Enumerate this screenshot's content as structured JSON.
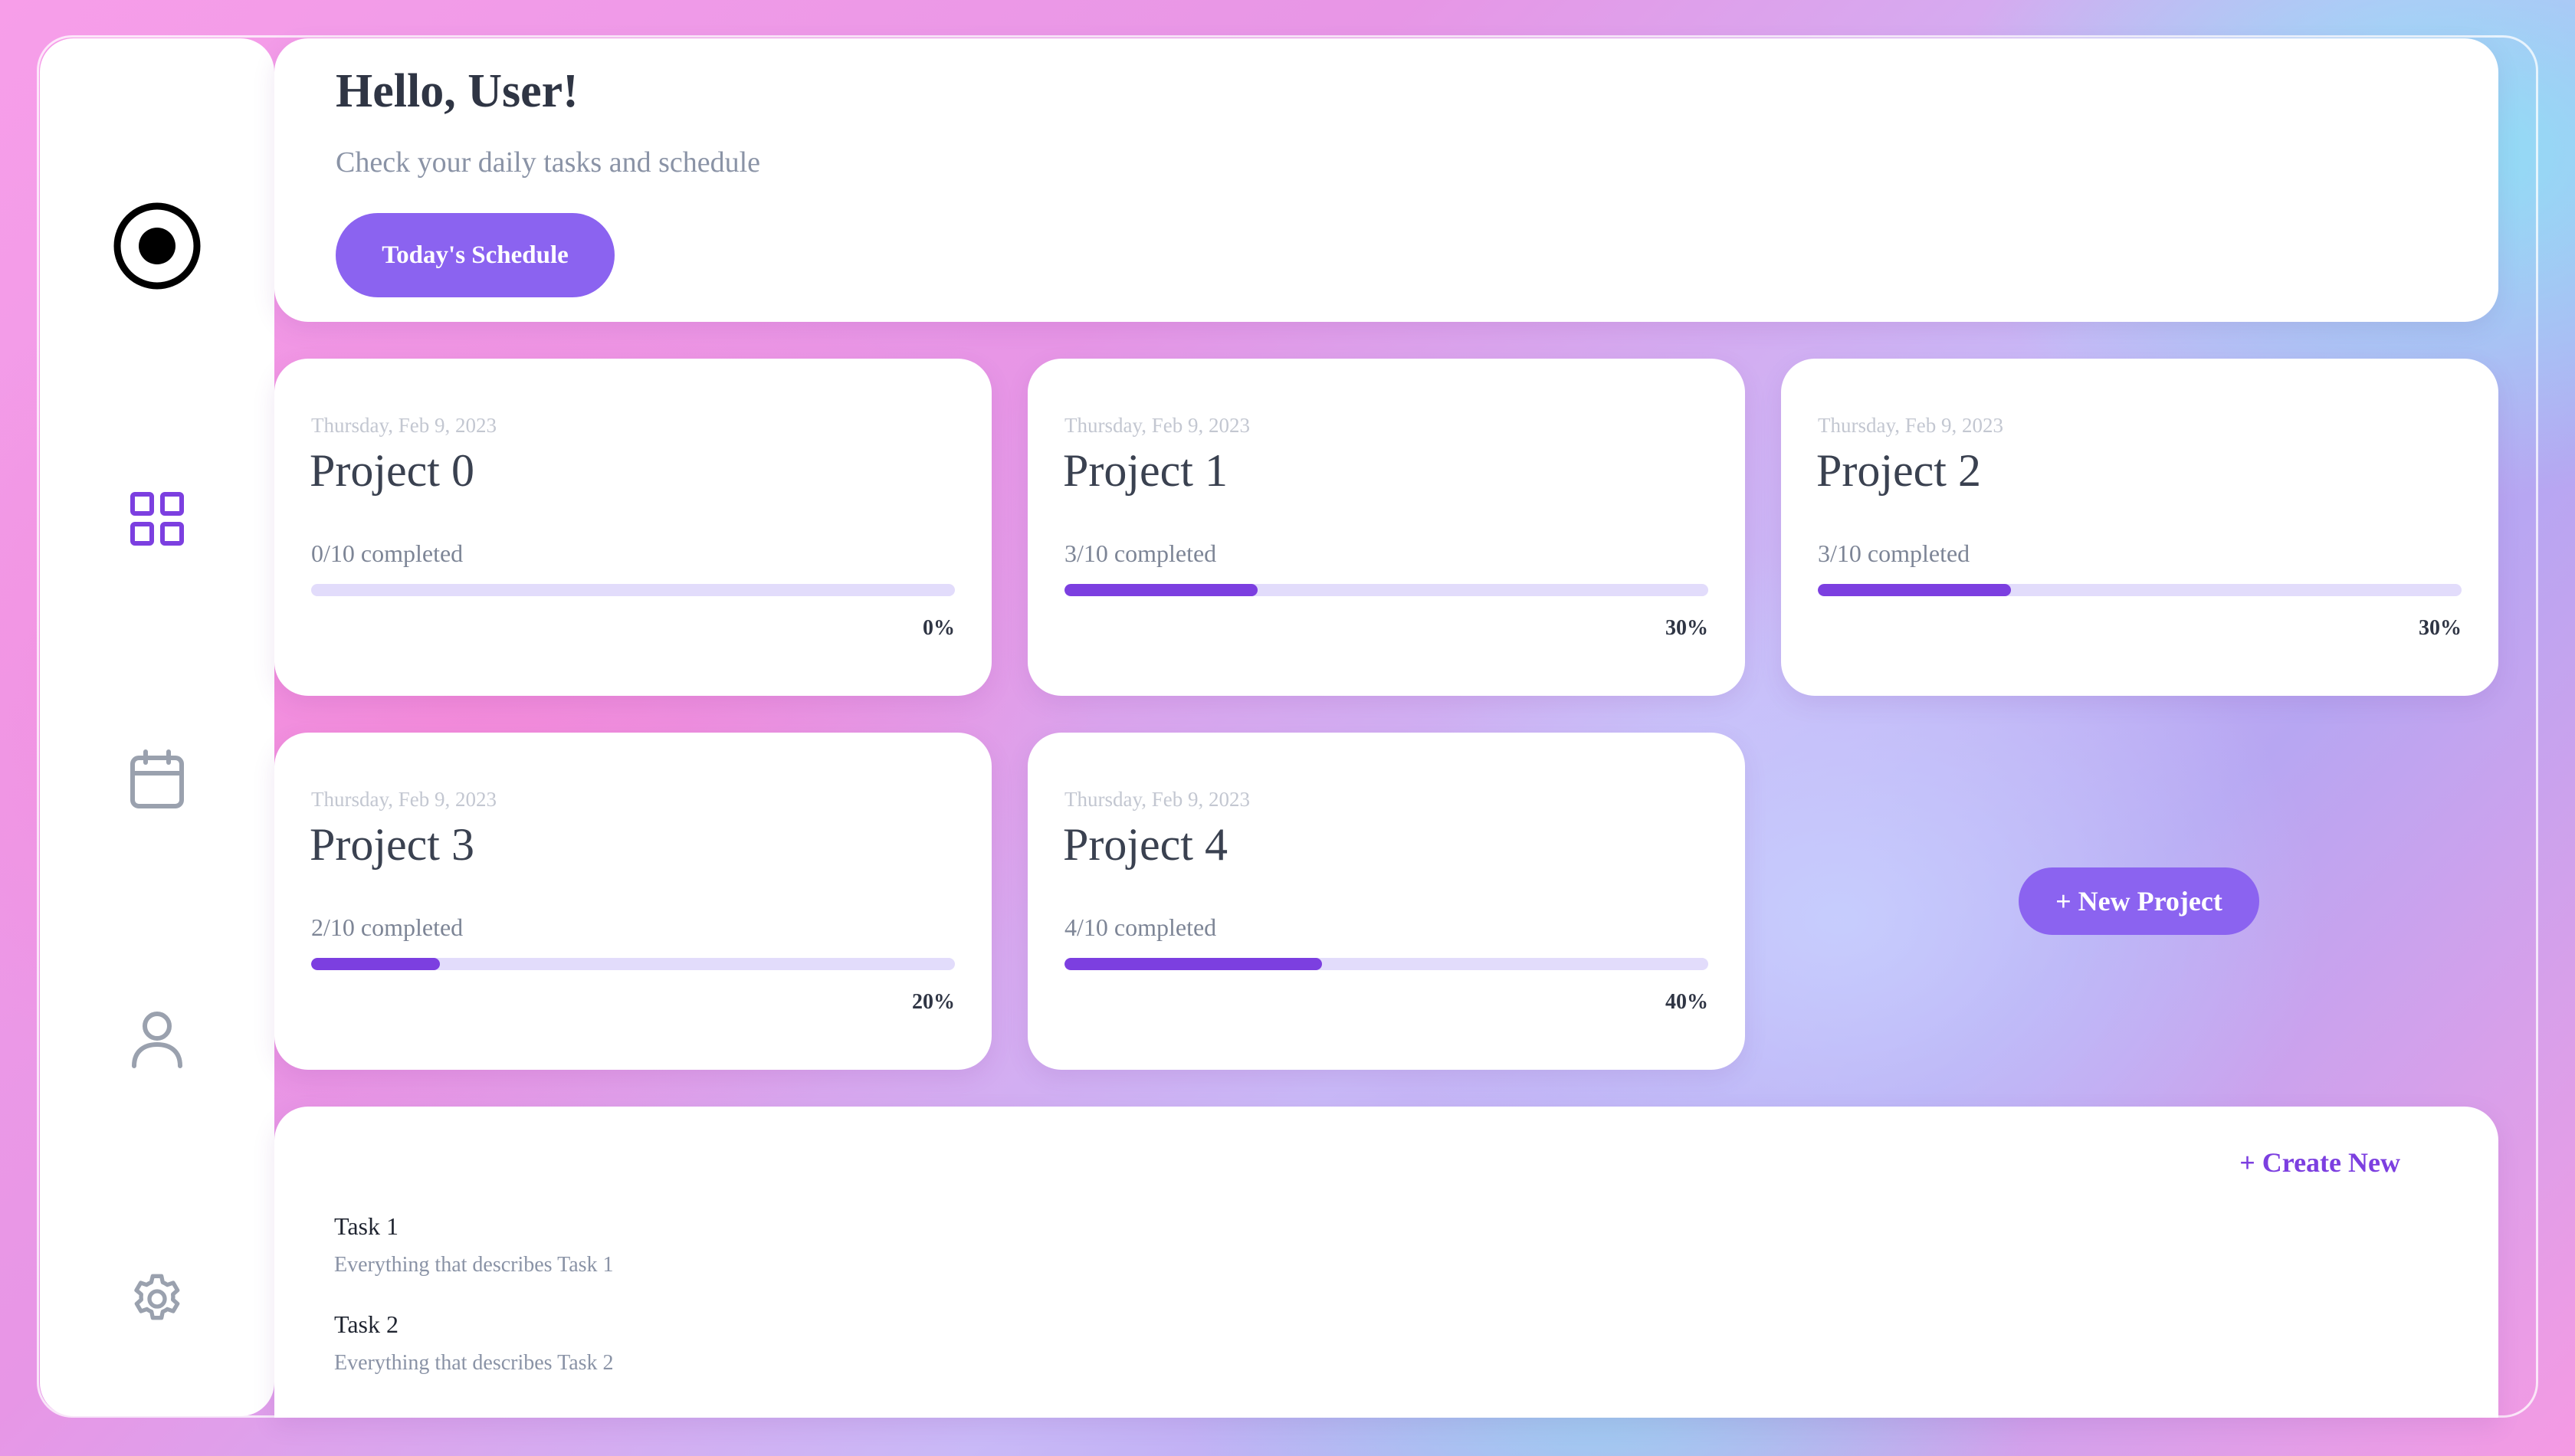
{
  "header": {
    "greeting": "Hello, User!",
    "subtitle": "Check your daily tasks and schedule",
    "schedule_button": "Today's Schedule"
  },
  "sidebar": {
    "items": [
      {
        "icon": "logo-icon",
        "active": false
      },
      {
        "icon": "dashboard-grid-icon",
        "active": true
      },
      {
        "icon": "calendar-icon",
        "active": false
      },
      {
        "icon": "user-icon",
        "active": false
      },
      {
        "icon": "settings-gear-icon",
        "active": false
      }
    ]
  },
  "projects": [
    {
      "date": "Thursday, Feb 9, 2023",
      "name": "Project 0",
      "completed": "0/10 completed",
      "percent_label": "0%",
      "progress": 0
    },
    {
      "date": "Thursday, Feb 9, 2023",
      "name": "Project 1",
      "completed": "3/10 completed",
      "percent_label": "30%",
      "progress": 30
    },
    {
      "date": "Thursday, Feb 9, 2023",
      "name": "Project 2",
      "completed": "3/10 completed",
      "percent_label": "30%",
      "progress": 30
    },
    {
      "date": "Thursday, Feb 9, 2023",
      "name": "Project 3",
      "completed": "2/10 completed",
      "percent_label": "20%",
      "progress": 20
    },
    {
      "date": "Thursday, Feb 9, 2023",
      "name": "Project 4",
      "completed": "4/10 completed",
      "percent_label": "40%",
      "progress": 40
    }
  ],
  "new_project_button": "+ New Project",
  "tasks": {
    "create_label": "+ Create New",
    "items": [
      {
        "title": "Task 1",
        "description": "Everything that describes Task 1"
      },
      {
        "title": "Task 2",
        "description": "Everything that describes Task 2"
      }
    ]
  },
  "colors": {
    "accent": "#8b63f0",
    "progress_fill": "#7c3fe0",
    "progress_track": "#e2dcfb",
    "text_dark": "#2f3544",
    "text_muted": "#8a93a6"
  }
}
